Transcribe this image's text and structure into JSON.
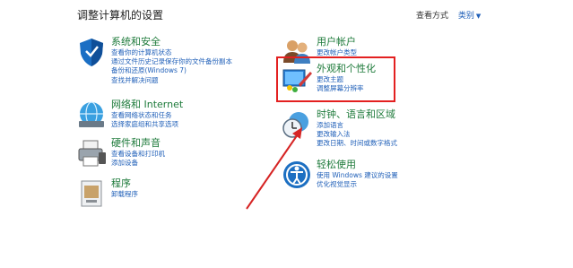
{
  "page": {
    "title": "调整计算机的设置"
  },
  "view": {
    "label": "查看方式",
    "selected": "类别"
  },
  "categories": [
    {
      "name": "系统和安全",
      "icon": "shield-icon",
      "links": [
        "查看你的计算机状态",
        "通过文件历史记录保存你的文件备份副本",
        "备份和还原(Windows 7)",
        "查找并解决问题"
      ]
    },
    {
      "name": "网络和 Internet",
      "icon": "network-globe-icon",
      "links": [
        "查看网络状态和任务",
        "选择家庭组和共享选项"
      ]
    },
    {
      "name": "硬件和声音",
      "icon": "printer-icon",
      "links": [
        "查看设备和打印机",
        "添加设备"
      ]
    },
    {
      "name": "程序",
      "icon": "programs-icon",
      "links": [
        "卸载程序"
      ]
    },
    {
      "name": "用户帐户",
      "icon": "users-icon",
      "links": [
        "更改帐户类型"
      ]
    },
    {
      "name": "外观和个性化",
      "icon": "appearance-icon",
      "links": [
        "更改主题",
        "调整屏幕分辨率"
      ]
    },
    {
      "name": "时钟、语言和区域",
      "icon": "clock-globe-icon",
      "links": [
        "添加语言",
        "更改输入法",
        "更改日期、时间或数字格式"
      ]
    },
    {
      "name": "轻松使用",
      "icon": "accessibility-icon",
      "links": [
        "使用 Windows 建议的设置",
        "优化视觉显示"
      ]
    }
  ],
  "colors": {
    "heading": "#1d7a3a",
    "link": "#1f5fb8",
    "highlight": "#e32020"
  }
}
